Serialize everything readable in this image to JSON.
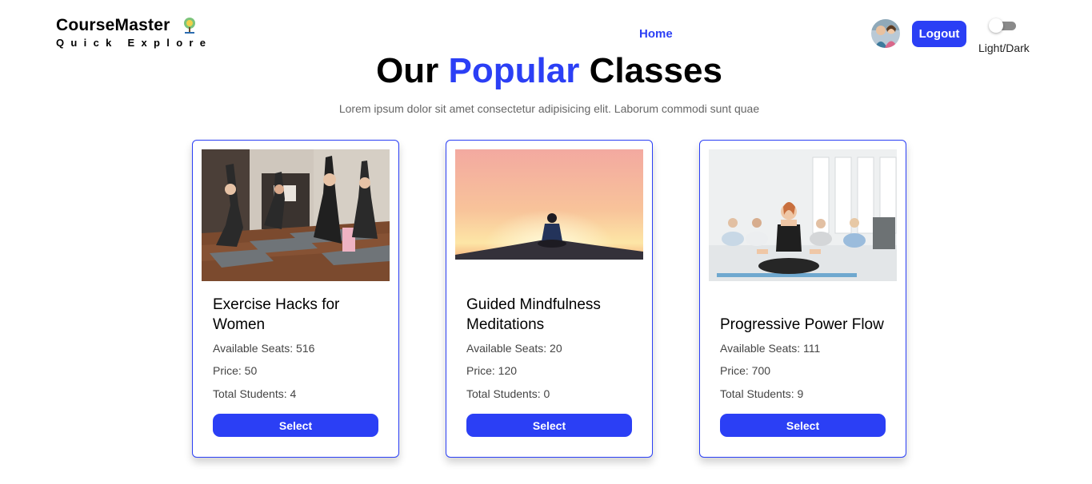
{
  "brand": {
    "title": "CourseMaster",
    "tagline": "Quick Explore"
  },
  "nav": {
    "home": "Home"
  },
  "header": {
    "logout_label": "Logout",
    "theme_label": "Light/Dark"
  },
  "hero": {
    "title_pre": "Our",
    "title_accent": "Popular",
    "title_post": "Classes",
    "subtitle": "Lorem ipsum dolor sit amet consectetur adipisicing elit. Laborum commodi sunt quae"
  },
  "colors": {
    "accent": "#2b3ff5",
    "text": "#000000",
    "muted": "#666666"
  },
  "classes": [
    {
      "title": "Exercise Hacks for Women",
      "seats": "Available Seats: 516",
      "price": "Price: 50",
      "students": "Total Students: 4",
      "button": "Select"
    },
    {
      "title": "Guided Mindfulness Meditations",
      "seats": "Available Seats: 20",
      "price": "Price: 120",
      "students": "Total Students: 0",
      "button": "Select"
    },
    {
      "title": "Progressive Power Flow",
      "seats": "Available Seats: 111",
      "price": "Price: 700",
      "students": "Total Students: 9",
      "button": "Select"
    }
  ]
}
